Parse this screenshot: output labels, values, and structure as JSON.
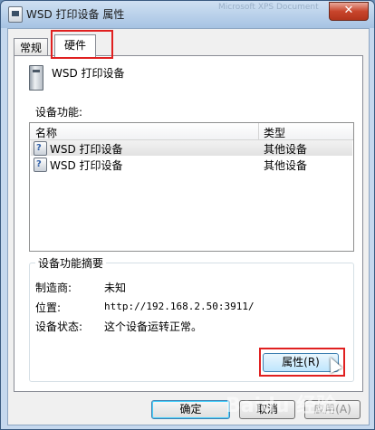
{
  "window": {
    "title": "WSD 打印设备 属性",
    "close_glyph": "✕",
    "ghost_text": "Microsoft XPS Document"
  },
  "tabs": [
    {
      "label": "常规",
      "active": false
    },
    {
      "label": "硬件",
      "active": true
    }
  ],
  "device": {
    "name": "WSD 打印设备",
    "icon": "printer-device-icon"
  },
  "functions": {
    "section_label": "设备功能:",
    "columns": {
      "name": "名称",
      "type": "类型"
    },
    "rows": [
      {
        "name": "WSD 打印设备",
        "type": "其他设备",
        "icon": "unknown-device-icon",
        "selected": true
      },
      {
        "name": "WSD 打印设备",
        "type": "其他设备",
        "icon": "unknown-device-icon",
        "selected": false
      }
    ]
  },
  "summary": {
    "title": "设备功能摘要",
    "manufacturer_label": "制造商:",
    "manufacturer_value": "未知",
    "location_label": "位置:",
    "location_value": "http://192.168.2.50:3911/",
    "status_label": "设备状态:",
    "status_value": "这个设备运转正常。"
  },
  "buttons": {
    "properties": "属性(R)",
    "ok": "确定",
    "cancel": "取消",
    "apply": "应用(A)"
  },
  "watermark": "Baidu 经验",
  "colors": {
    "highlight": "#e02020",
    "close": "#c8452c"
  }
}
